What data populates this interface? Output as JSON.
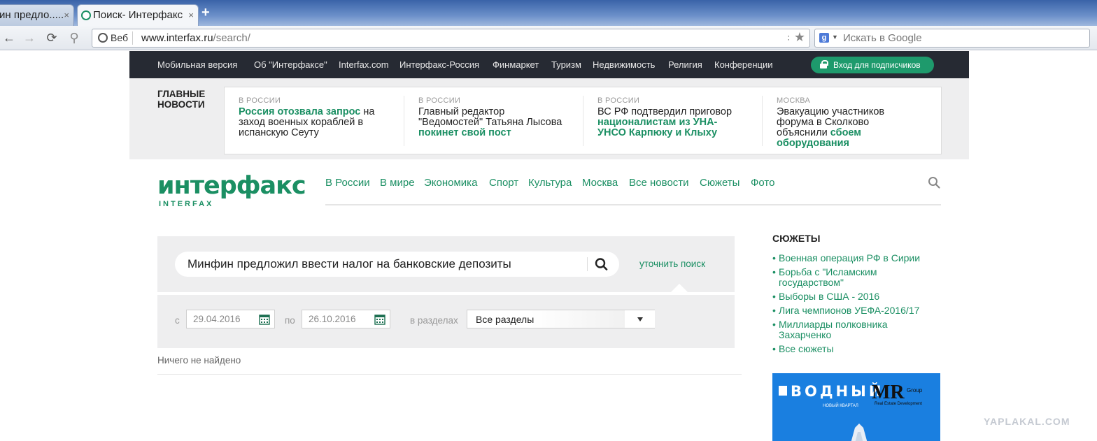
{
  "browser": {
    "tabs": [
      {
        "label": "ин предло.....",
        "close": "×"
      },
      {
        "label": "Поиск- Интерфакс",
        "close": "×"
      }
    ],
    "new_tab": "+",
    "web_chip": "Веб",
    "url_host": "www.interfax.ru",
    "url_path": "/search/",
    "search_placeholder": "Искать в Google",
    "search_engine_letter": "g"
  },
  "site_nav": {
    "links": [
      "Мобильная версия",
      "Об \"Интерфаксе\"",
      "Interfax.com",
      "Интерфакс-Россия",
      "Финмаркет",
      "Туризм",
      "Недвижимость",
      "Религия",
      "Конференции"
    ],
    "login": "Вход для подписчиков"
  },
  "headlines": {
    "label": "ГЛАВНЫЕ НОВОСТИ",
    "items": [
      {
        "category": "В РОССИИ",
        "before": "",
        "highlight": "Россия отозвала запрос",
        "after": " на заход военных кораблей в испанскую Сеуту"
      },
      {
        "category": "В РОССИИ",
        "before": "Главный редактор \"Ведомостей\" Татьяна Лысова ",
        "highlight": "покинет свой пост",
        "after": ""
      },
      {
        "category": "В РОССИИ",
        "before": "ВС РФ подтвердил приговор ",
        "highlight": "националистам из УНА-УНСО Карпюку и Клыху",
        "after": ""
      },
      {
        "category": "МОСКВА",
        "before": "Эвакуацию участников форума в Сколково объяснили ",
        "highlight": "сбоем оборудования",
        "after": ""
      }
    ]
  },
  "logo": {
    "main": "интерфакс",
    "sub": "INTERFAX"
  },
  "main_menu": [
    "В России",
    "В мире",
    "Экономика",
    "Спорт",
    "Культура",
    "Москва",
    "Все новости",
    "Сюжеты",
    "Фото"
  ],
  "search": {
    "query": "Минфин предложил ввести налог на банковские депозиты",
    "refine": "уточнить поиск",
    "from_label": "с",
    "from_date": "29.04.2016",
    "to_label": "по",
    "to_date": "26.10.2016",
    "sections_label": "в разделах",
    "sections_value": "Все разделы",
    "not_found": "Ничего не найдено"
  },
  "sidebar": {
    "title": "СЮЖЕТЫ",
    "stories": [
      "Военная операция РФ в Сирии",
      "Борьба с \"Исламским государством\"",
      "Выборы в США - 2016",
      "Лига чемпионов УЕФА-2016/17",
      "Миллиарды полковника Захарченко",
      "Все сюжеты"
    ]
  },
  "ad": {
    "brand": "ВОДНЫЙ",
    "brand_sub": "НОВЫЙ КВАРТАЛ",
    "developer": "MR",
    "developer_group": "Group",
    "developer_sub": "Real Estate Development"
  },
  "watermark": "YAPLAKAL.COM",
  "colors": {
    "accent": "#1b8f63",
    "nav_bg": "#262a33",
    "panel_bg": "#eeeeef"
  }
}
